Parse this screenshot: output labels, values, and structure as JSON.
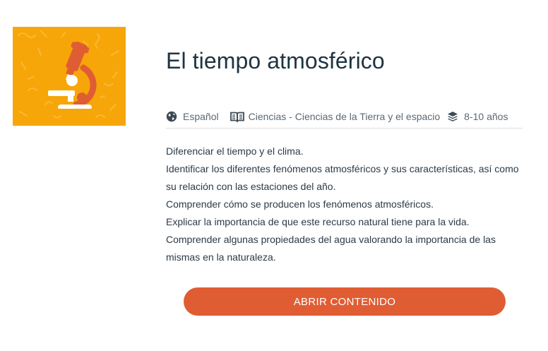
{
  "resource": {
    "title": "El tiempo atmosférico",
    "thumbnail_icon": "microscope-icon",
    "thumbnail_bg": "#f6a608",
    "meta": {
      "language": {
        "icon": "globe-icon",
        "label": "Español"
      },
      "subject": {
        "icon": "book-icon",
        "label": "Ciencias - Ciencias de la Tierra y el espacio"
      },
      "age": {
        "icon": "layers-icon",
        "label": "8-10 años"
      }
    },
    "objectives": [
      "Diferenciar el tiempo y el clima.",
      "Identificar los diferentes fenómenos atmosféricos y sus características, así como su relación con las estaciones del año.",
      "Comprender cómo se producen los fenómenos atmosféricos.",
      "Explicar la importancia de que este recurso natural tiene para la vida.",
      "Comprender algunas propiedades del agua valorando la importancia de las mismas en la naturaleza."
    ],
    "open_button_label": "ABRIR CONTENIDO",
    "accent_color": "#e05d34"
  }
}
